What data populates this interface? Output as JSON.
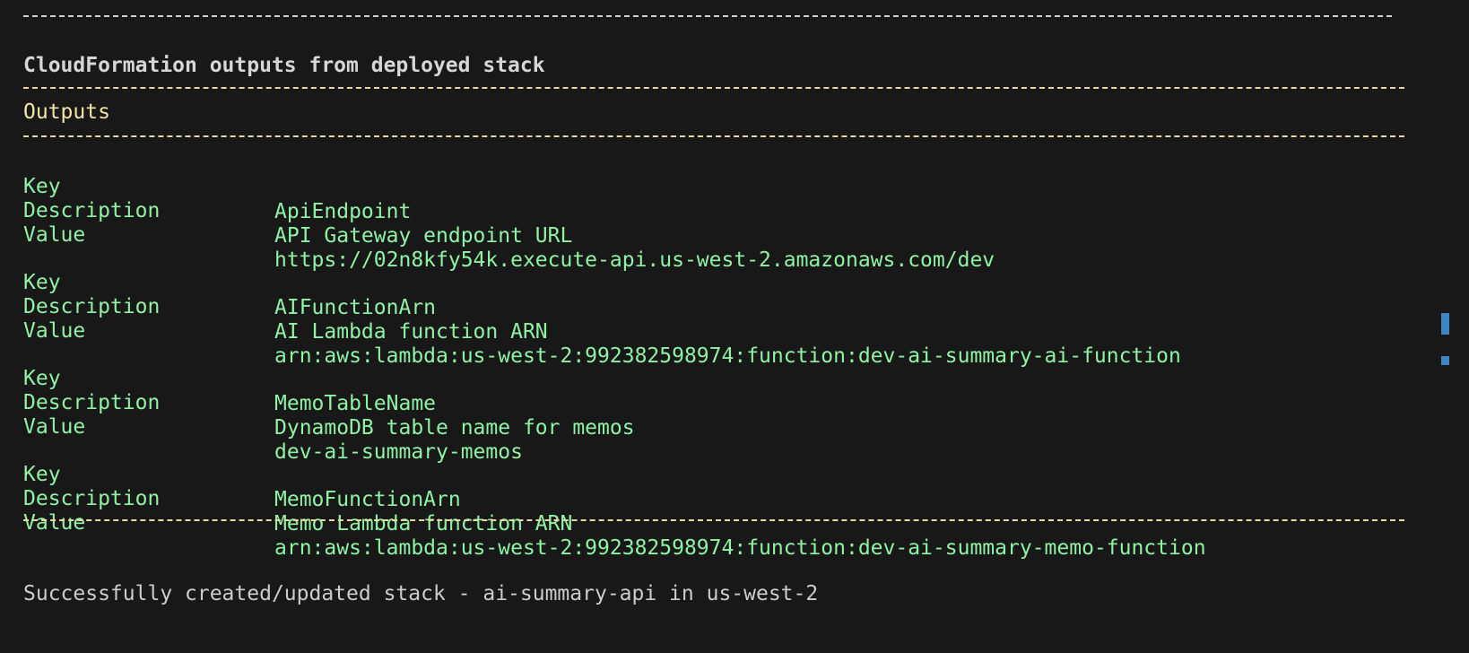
{
  "terminal": {
    "heading": "CloudFormation outputs from deployed stack",
    "section": "Outputs",
    "outputs": [
      {
        "key_label": "Key",
        "key": "ApiEndpoint",
        "desc_label": "Description",
        "description": "API Gateway endpoint URL",
        "value_label": "Value",
        "value": "https://02n8kfy54k.execute-api.us-west-2.amazonaws.com/dev"
      },
      {
        "key_label": "Key",
        "key": "AIFunctionArn",
        "desc_label": "Description",
        "description": "AI Lambda function ARN",
        "value_label": "Value",
        "value": "arn:aws:lambda:us-west-2:992382598974:function:dev-ai-summary-ai-function"
      },
      {
        "key_label": "Key",
        "key": "MemoTableName",
        "desc_label": "Description",
        "description": "DynamoDB table name for memos",
        "value_label": "Value",
        "value": "dev-ai-summary-memos"
      },
      {
        "key_label": "Key",
        "key": "MemoFunctionArn",
        "desc_label": "Description",
        "description": "Memo Lambda function ARN",
        "value_label": "Value",
        "value": "arn:aws:lambda:us-west-2:992382598974:function:dev-ai-summary-memo-function"
      }
    ],
    "status_message": "Successfully created/updated stack - ai-summary-api in us-west-2"
  },
  "colors": {
    "background": "#181818",
    "rule": "#e8d9a3",
    "section": "#f0e5a6",
    "output_text": "#8ff2a3",
    "plain_text": "#cccccc",
    "scroll_marker": "#3c87c2"
  }
}
